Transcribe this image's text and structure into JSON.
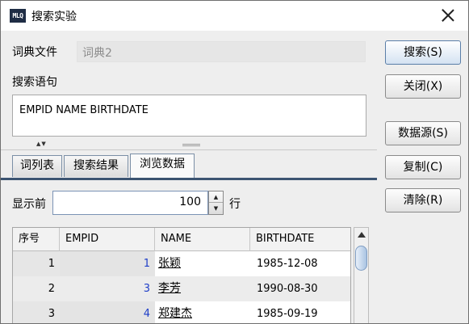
{
  "titlebar": {
    "title": "搜索实验",
    "logo_text": "MLQ"
  },
  "dict": {
    "label": "词典文件",
    "value": "词典2"
  },
  "query": {
    "label": "搜索语句",
    "value": "EMPID NAME BIRTHDATE"
  },
  "buttons": {
    "search": "搜索(S)",
    "close": "关闭(X)",
    "datasource": "数据源(S)",
    "copy": "复制(C)",
    "clear": "清除(R)"
  },
  "tabs": [
    "词列表",
    "搜索结果",
    "浏览数据"
  ],
  "active_tab": "浏览数据",
  "show": {
    "label": "显示前",
    "value": "100",
    "unit": "行"
  },
  "table": {
    "headers": [
      "序号",
      "EMPID",
      "NAME",
      "BIRTHDATE"
    ],
    "rows": [
      {
        "seq": "1",
        "empid": "1",
        "name": "张颖",
        "birthdate": "1985-12-08"
      },
      {
        "seq": "2",
        "empid": "3",
        "name": "李芳",
        "birthdate": "1990-08-30"
      },
      {
        "seq": "3",
        "empid": "4",
        "name": "郑建杰",
        "birthdate": "1985-09-19"
      }
    ]
  },
  "icons": {
    "close": "close-icon",
    "spin_up": "spin-up-icon",
    "spin_down": "spin-down-icon",
    "scroll_up": "scroll-up-icon"
  },
  "colors": {
    "accent": "#3c5471",
    "id_link": "#1e3ec8"
  }
}
